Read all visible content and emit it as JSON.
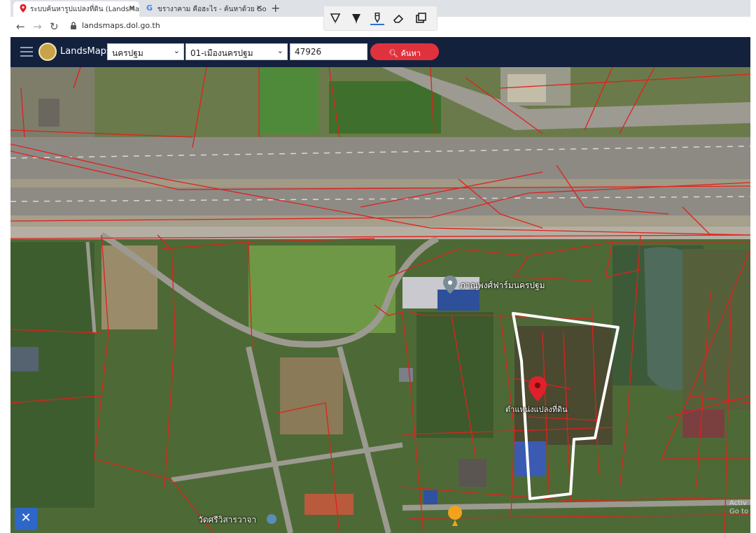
{
  "browser": {
    "tabs": [
      {
        "label": "ระบบค้นหารูปแปลงที่ดิน (LandsMaps)",
        "active": true,
        "icon": "location-pin-icon"
      },
      {
        "label": "ขรางาคาม คือฮะไร - ค้นหาด้วย Google",
        "active": false,
        "icon": "google-icon"
      }
    ],
    "new_tab_icon": "plus-icon",
    "address": {
      "url": "landsmaps.dol.go.th"
    }
  },
  "drawing_toolbar": {
    "tools": [
      "highlighter-icon",
      "marker-icon",
      "pen-icon",
      "eraser-icon",
      "copy-icon"
    ],
    "selected": "pen-icon"
  },
  "header": {
    "brand": "LandsMaps",
    "province": "นครปฐม",
    "district": "01-เมืองนครปฐม",
    "parcel_number": "47926",
    "search_label": "ค้นหา"
  },
  "map": {
    "poi_labels": [
      {
        "text": "ภาณุพงศ์ฟาร์มนครปฐม"
      },
      {
        "text": "ตำแหน่งแปลงที่ดิน"
      },
      {
        "text": "วัดศรีวิสารวาจา"
      }
    ],
    "pin_color": "#e0202a",
    "boundary_color": "#e0201c",
    "highlight_color": "#ffffff",
    "watermark": "Activ Go to"
  }
}
